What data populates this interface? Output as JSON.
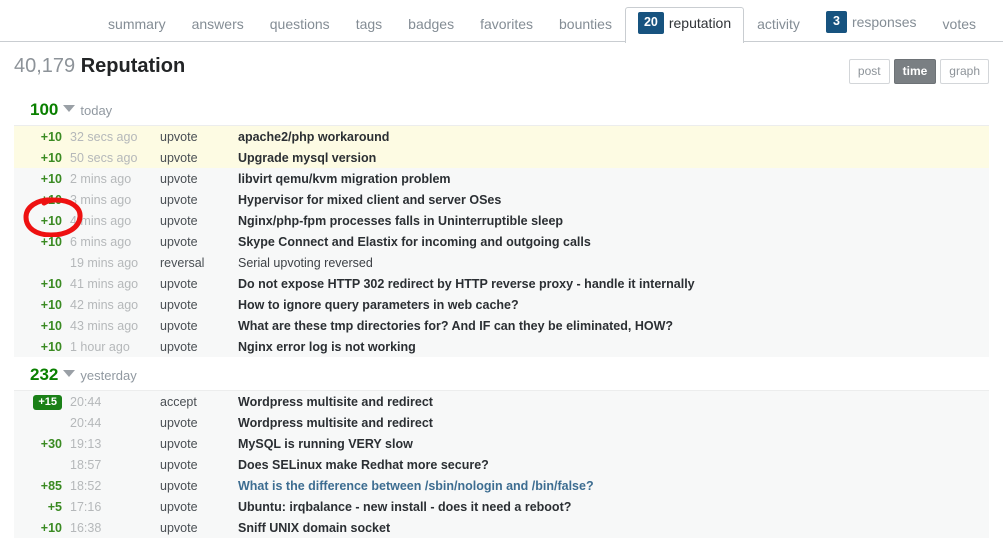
{
  "colors": {
    "accent_badge": "#17537f",
    "rep_green": "#3a8a22",
    "day_total_green": "#0a8000",
    "accepted_badge": "#1a8017",
    "link_blue": "#3d6d91",
    "highlight_row": "#fdfbe3",
    "annotation_red": "#ee1111"
  },
  "tabs": [
    {
      "label": "summary",
      "count": null,
      "active": false
    },
    {
      "label": "answers",
      "count": null,
      "active": false
    },
    {
      "label": "questions",
      "count": null,
      "active": false
    },
    {
      "label": "tags",
      "count": null,
      "active": false
    },
    {
      "label": "badges",
      "count": null,
      "active": false
    },
    {
      "label": "favorites",
      "count": null,
      "active": false
    },
    {
      "label": "bounties",
      "count": null,
      "active": false
    },
    {
      "label": "reputation",
      "count": "20",
      "active": true
    },
    {
      "label": "activity",
      "count": null,
      "active": false
    },
    {
      "label": "responses",
      "count": "3",
      "active": false
    },
    {
      "label": "votes",
      "count": null,
      "active": false
    }
  ],
  "header": {
    "reputation_number": "40,179",
    "title_word": "Reputation"
  },
  "view_switch": {
    "options": [
      {
        "label": "post",
        "selected": false
      },
      {
        "label": "time",
        "selected": true
      },
      {
        "label": "graph",
        "selected": false
      }
    ]
  },
  "groups": [
    {
      "total": "100",
      "label": "today",
      "rows": [
        {
          "rep": "+10",
          "badge": false,
          "time": "32 secs ago",
          "type": "upvote",
          "title": "apache2/php workaround",
          "style": "bold",
          "highlight": true
        },
        {
          "rep": "+10",
          "badge": false,
          "time": "50 secs ago",
          "type": "upvote",
          "title": "Upgrade mysql version",
          "style": "bold",
          "highlight": true
        },
        {
          "rep": "+10",
          "badge": false,
          "time": "2 mins ago",
          "type": "upvote",
          "title": "libvirt qemu/kvm migration problem",
          "style": "bold",
          "highlight": false
        },
        {
          "rep": "+10",
          "badge": false,
          "time": "3 mins ago",
          "type": "upvote",
          "title": "Hypervisor for mixed client and server OSes",
          "style": "bold",
          "highlight": false
        },
        {
          "rep": "+10",
          "badge": false,
          "time": "4 mins ago",
          "type": "upvote",
          "title": "Nginx/php-fpm processes falls in Uninterruptible sleep",
          "style": "bold",
          "highlight": false
        },
        {
          "rep": "+10",
          "badge": false,
          "time": "6 mins ago",
          "type": "upvote",
          "title": "Skype Connect and Elastix for incoming and outgoing calls",
          "style": "bold",
          "highlight": false
        },
        {
          "rep": "",
          "badge": false,
          "time": "19 mins ago",
          "type": "reversal",
          "title": "Serial upvoting reversed",
          "style": "plain",
          "highlight": false
        },
        {
          "rep": "+10",
          "badge": false,
          "time": "41 mins ago",
          "type": "upvote",
          "title": "Do not expose HTTP 302 redirect by HTTP reverse proxy - handle it internally",
          "style": "bold",
          "highlight": false
        },
        {
          "rep": "+10",
          "badge": false,
          "time": "42 mins ago",
          "type": "upvote",
          "title": "How to ignore query parameters in web cache?",
          "style": "bold",
          "highlight": false
        },
        {
          "rep": "+10",
          "badge": false,
          "time": "43 mins ago",
          "type": "upvote",
          "title": "What are these tmp directories for? And IF can they be eliminated, HOW?",
          "style": "bold",
          "highlight": false
        },
        {
          "rep": "+10",
          "badge": false,
          "time": "1 hour ago",
          "type": "upvote",
          "title": "Nginx error log is not working",
          "style": "bold",
          "highlight": false
        }
      ]
    },
    {
      "total": "232",
      "label": "yesterday",
      "rows": [
        {
          "rep": "+15",
          "badge": true,
          "time": "20:44",
          "type": "accept",
          "title": "Wordpress multisite and redirect",
          "style": "bold",
          "highlight": false
        },
        {
          "rep": "",
          "badge": false,
          "time": "20:44",
          "type": "upvote",
          "title": "Wordpress multisite and redirect",
          "style": "bold",
          "highlight": false
        },
        {
          "rep": "+30",
          "badge": false,
          "time": "19:13",
          "type": "upvote",
          "title": "MySQL is running VERY slow",
          "style": "bold",
          "highlight": false
        },
        {
          "rep": "",
          "badge": false,
          "time": "18:57",
          "type": "upvote",
          "title": "Does SELinux make Redhat more secure?",
          "style": "bold",
          "highlight": false
        },
        {
          "rep": "+85",
          "badge": false,
          "time": "18:52",
          "type": "upvote",
          "title": "What is the difference between /sbin/nologin and /bin/false?",
          "style": "link",
          "highlight": false
        },
        {
          "rep": "+5",
          "badge": false,
          "time": "17:16",
          "type": "upvote",
          "title": "Ubuntu: irqbalance - new install - does it need a reboot?",
          "style": "bold",
          "highlight": false
        },
        {
          "rep": "+10",
          "badge": false,
          "time": "16:38",
          "type": "upvote",
          "title": "Sniff UNIX domain socket",
          "style": "bold",
          "highlight": false
        }
      ]
    }
  ],
  "annotation": {
    "shape": "hand-drawn-red-ellipse",
    "target": "reputation-value-of-serial-upvoting-reversed-row"
  }
}
